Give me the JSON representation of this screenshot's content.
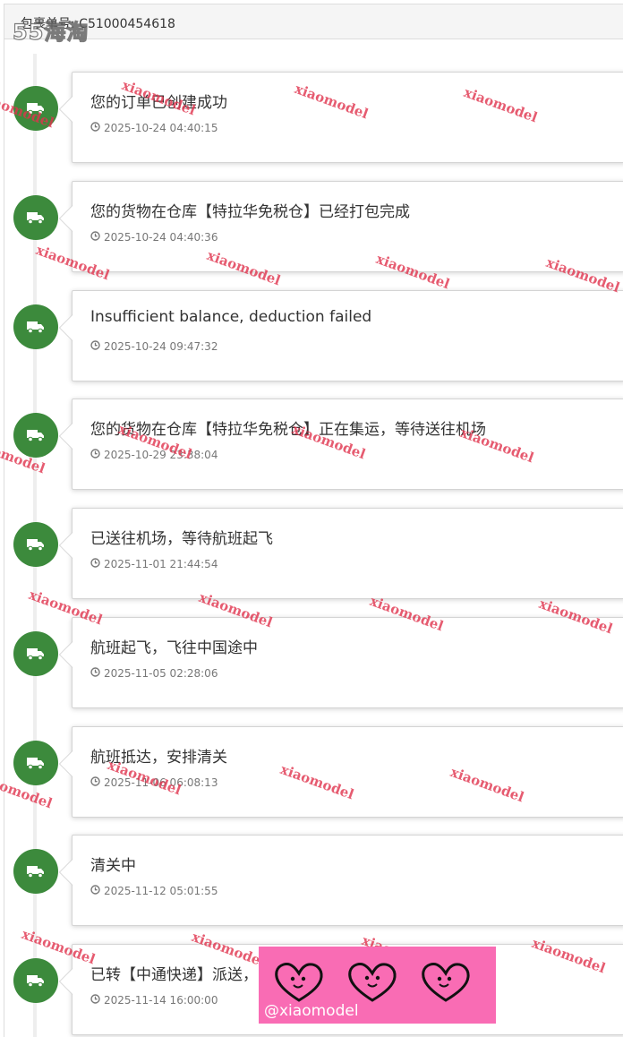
{
  "header": {
    "title": "包裹单号: C51000454618",
    "logo_text": "55海淘"
  },
  "timeline": {
    "icon": "truck-icon",
    "icon_color": "#3c8a3c",
    "items": [
      {
        "title": "您的订单已创建成功",
        "time": "2025-10-24 04:40:15"
      },
      {
        "title": "您的货物在仓库【特拉华免税仓】已经打包完成",
        "time": "2025-10-24 04:40:36"
      },
      {
        "title": "Insufficient balance, deduction failed",
        "time": "2025-10-24 09:47:32"
      },
      {
        "title": "您的货物在仓库【特拉华免税仓】正在集运，等待送往机场",
        "time": "2025-10-29 23:38:04"
      },
      {
        "title": "已送往机场，等待航班起飞",
        "time": "2025-11-01 21:44:54"
      },
      {
        "title": "航班起飞，飞往中国途中",
        "time": "2025-11-05 02:28:06"
      },
      {
        "title": "航班抵达，安排清关",
        "time": "2025-11-06 06:08:13"
      },
      {
        "title": "清关中",
        "time": "2025-11-12 05:01:55"
      },
      {
        "title": "已转【中通快递】派送，",
        "time": "2025-11-14 16:00:00"
      }
    ]
  },
  "watermark": {
    "text": "xiaomodel",
    "color": "#e0334d"
  },
  "sticker": {
    "label": "@xiaomodel",
    "background": "#f96cb4"
  }
}
